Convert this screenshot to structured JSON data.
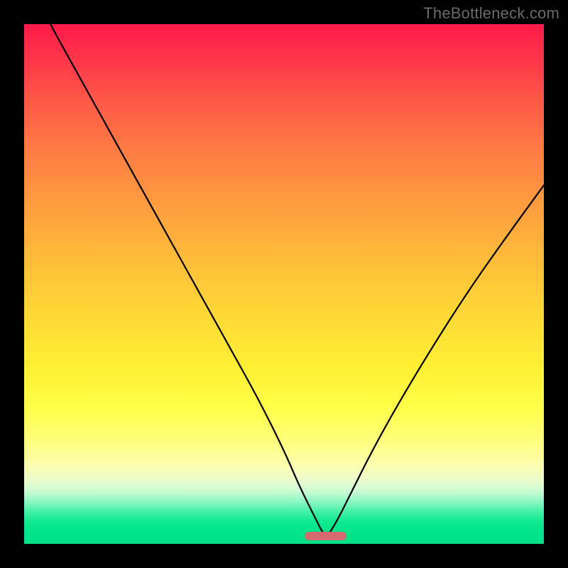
{
  "watermark": "TheBottleneck.com",
  "colors": {
    "frame": "#000000",
    "gradient_top": "#ff1a4a",
    "gradient_mid": "#fff034",
    "gradient_bottom": "#00e087",
    "curve": "#000000",
    "marker": "#d46a6e"
  },
  "chart_data": {
    "type": "line",
    "title": "",
    "xlabel": "",
    "ylabel": "",
    "xlim": [
      0,
      100
    ],
    "ylim": [
      0,
      100
    ],
    "marker": {
      "x_center": 58,
      "x_half_width": 4,
      "y": 1.5
    },
    "series": [
      {
        "name": "curve",
        "x": [
          0,
          5,
          10,
          15,
          20,
          25,
          30,
          35,
          40,
          45,
          50,
          53,
          56,
          58,
          60,
          63,
          67,
          72,
          78,
          85,
          92,
          100
        ],
        "values": [
          110,
          100,
          91,
          82,
          73,
          64,
          55,
          46,
          37,
          28,
          18,
          11,
          5,
          1,
          4,
          10,
          18,
          27,
          37,
          48,
          58,
          69
        ]
      }
    ],
    "grid": false,
    "legend": false
  }
}
